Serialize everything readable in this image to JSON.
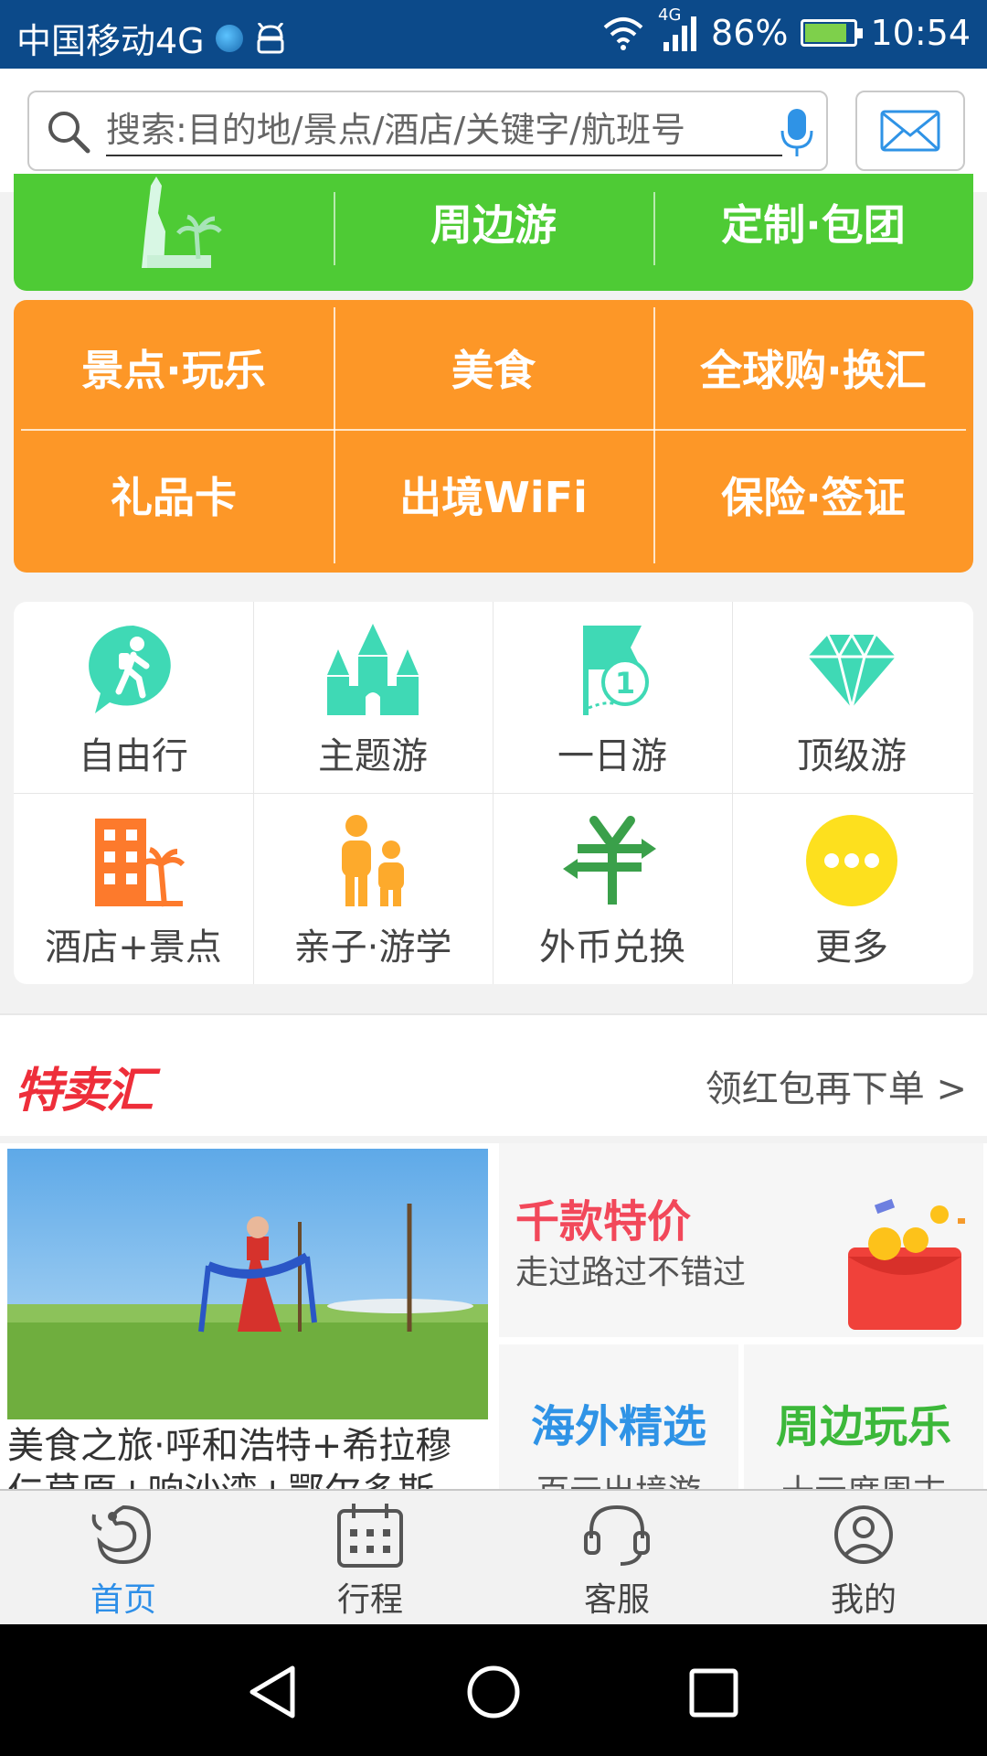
{
  "status_bar": {
    "carrier": "中国移动4G",
    "network": "4G",
    "battery": "86%",
    "battery_level": 0.86,
    "time": "10:54"
  },
  "search": {
    "placeholder": "搜索:目的地/景点/酒店/关键字/航班号"
  },
  "green_row": {
    "items": [
      "周边游",
      "定制·包团"
    ]
  },
  "orange_grid": {
    "items": [
      "景点·玩乐",
      "美食",
      "全球购·换汇",
      "礼品卡",
      "出境WiFi",
      "保险·签证"
    ]
  },
  "icon_grid": {
    "items": [
      {
        "label": "自由行",
        "icon": "hiker-icon"
      },
      {
        "label": "主题游",
        "icon": "castle-icon"
      },
      {
        "label": "一日游",
        "icon": "flag-one-icon"
      },
      {
        "label": "顶级游",
        "icon": "diamond-icon"
      },
      {
        "label": "酒店+景点",
        "icon": "hotel-palm-icon"
      },
      {
        "label": "亲子·游学",
        "icon": "family-icon"
      },
      {
        "label": "外币兑换",
        "icon": "currency-exchange-icon"
      },
      {
        "label": "更多",
        "icon": "more-icon"
      }
    ]
  },
  "deals": {
    "logo": "特卖汇",
    "promo": "领红包再下单 >",
    "photo_caption": "美食之旅·呼和浩特+希拉穆仁草原+响沙湾+鄂尔多斯",
    "big_card": {
      "title": "千款特价",
      "subtitle": "走过路过不错过"
    },
    "small_cards": [
      {
        "title": "海外精选",
        "subtitle": "百元出境游",
        "color": "#2f93e6"
      },
      {
        "title": "周边玩乐",
        "subtitle": "十元度周末",
        "color": "#3cb83a"
      }
    ]
  },
  "bottom_nav": {
    "tabs": [
      "首页",
      "行程",
      "客服",
      "我的"
    ],
    "active": "首页"
  },
  "colors": {
    "status_bar": "#0c4a8a",
    "green": "#4ecb35",
    "orange": "#fd9727",
    "icon_teal": "#3fd9b5",
    "accent_blue": "#2e8fe8",
    "deal_red": "#ee2e3a"
  }
}
